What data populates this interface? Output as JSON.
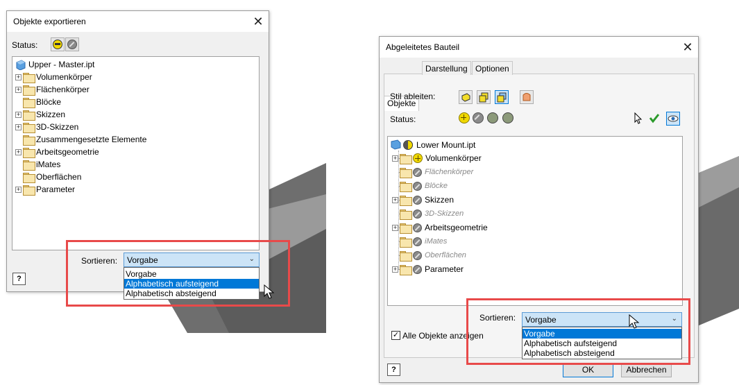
{
  "left_dialog": {
    "title": "Objekte exportieren",
    "close_glyph": "✕",
    "status_label": "Status:",
    "root_label": "Upper - Master.ipt",
    "tree_items": [
      {
        "label": "Volumenkörper",
        "expandable": true
      },
      {
        "label": "Flächenkörper",
        "expandable": true
      },
      {
        "label": "Blöcke",
        "expandable": false
      },
      {
        "label": "Skizzen",
        "expandable": true
      },
      {
        "label": "3D-Skizzen",
        "expandable": true
      },
      {
        "label": "Zusammengesetzte Elemente",
        "expandable": false
      },
      {
        "label": "Arbeitsgeometrie",
        "expandable": true
      },
      {
        "label": "iMates",
        "expandable": false
      },
      {
        "label": "Oberflächen",
        "expandable": false
      },
      {
        "label": "Parameter",
        "expandable": true
      }
    ],
    "sort_label": "Sortieren:",
    "sort_value": "Vorgabe",
    "sort_options": [
      "Vorgabe",
      "Alphabetisch aufsteigend",
      "Alphabetisch absteigend"
    ],
    "sort_highlighted": 1,
    "help_glyph": "?"
  },
  "right_dialog": {
    "title": "Abgeleitetes Bauteil",
    "close_glyph": "✕",
    "tabs": [
      "Objekte",
      "Darstellung",
      "Optionen"
    ],
    "active_tab": 0,
    "style_label": "Stil ableiten:",
    "status_label": "Status:",
    "root_label": "Lower Mount.ipt",
    "tree_items": [
      {
        "label": "Volumenkörper",
        "expandable": true,
        "status": "include",
        "style": "normal"
      },
      {
        "label": "Flächenkörper",
        "expandable": false,
        "status": "exclude",
        "style": "disabled"
      },
      {
        "label": "Blöcke",
        "expandable": false,
        "status": "exclude",
        "style": "disabled"
      },
      {
        "label": "Skizzen",
        "expandable": true,
        "status": "exclude",
        "style": "normal"
      },
      {
        "label": "3D-Skizzen",
        "expandable": false,
        "status": "exclude",
        "style": "disabled"
      },
      {
        "label": "Arbeitsgeometrie",
        "expandable": true,
        "status": "exclude",
        "style": "normal"
      },
      {
        "label": "iMates",
        "expandable": false,
        "status": "exclude",
        "style": "disabled"
      },
      {
        "label": "Oberflächen",
        "expandable": false,
        "status": "exclude",
        "style": "disabled"
      },
      {
        "label": "Parameter",
        "expandable": true,
        "status": "exclude",
        "style": "normal"
      }
    ],
    "sort_label": "Sortieren:",
    "sort_value": "Vorgabe",
    "sort_options": [
      "Vorgabe",
      "Alphabetisch aufsteigend",
      "Alphabetisch absteigend"
    ],
    "sort_highlighted": 0,
    "show_all_label": "Alle Objekte anzeigen",
    "show_all_checked": true,
    "ok_label": "OK",
    "cancel_label": "Abbrechen",
    "help_glyph": "?"
  },
  "colors": {
    "highlight_box": "#e84a4a",
    "selection": "#0078d7",
    "combo_bg": "#cce4f7"
  }
}
